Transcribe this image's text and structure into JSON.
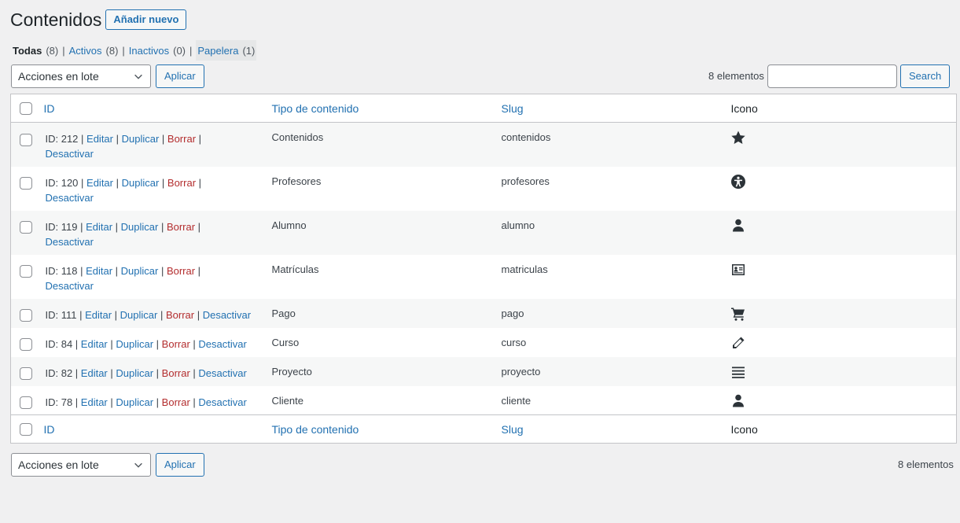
{
  "page": {
    "title": "Contenidos",
    "add_new": "Añadir nuevo"
  },
  "filters": [
    {
      "label": "Todas",
      "count": "(8)",
      "current": true
    },
    {
      "label": "Activos",
      "count": "(8)"
    },
    {
      "label": "Inactivos",
      "count": "(0)"
    },
    {
      "label": "Papelera",
      "count": "(1)"
    }
  ],
  "bulk": {
    "select_value": "Acciones en lote",
    "apply": "Aplicar"
  },
  "search": {
    "count": "8 elementos",
    "button": "Search",
    "value": ""
  },
  "columns": {
    "id": "ID",
    "tipo": "Tipo de contenido",
    "slug": "Slug",
    "icono": "Icono"
  },
  "actions": {
    "edit": "Editar",
    "duplicate": "Duplicar",
    "delete": "Borrar",
    "deactivate": "Desactivar"
  },
  "rows": [
    {
      "id": "ID: 212",
      "tipo": "Contenidos",
      "slug": "contenidos",
      "icon": "star-icon"
    },
    {
      "id": "ID: 120",
      "tipo": "Profesores",
      "slug": "profesores",
      "icon": "universal-access-icon"
    },
    {
      "id": "ID: 119",
      "tipo": "Alumno",
      "slug": "alumno",
      "icon": "person-icon"
    },
    {
      "id": "ID: 118",
      "tipo": "Matrículas",
      "slug": "matriculas",
      "icon": "id-card-icon"
    },
    {
      "id": "ID: 111",
      "tipo": "Pago",
      "slug": "pago",
      "icon": "cart-icon"
    },
    {
      "id": "ID: 84",
      "tipo": "Curso",
      "slug": "curso",
      "icon": "pencil-icon"
    },
    {
      "id": "ID: 82",
      "tipo": "Proyecto",
      "slug": "proyecto",
      "icon": "lines-icon"
    },
    {
      "id": "ID: 78",
      "tipo": "Cliente",
      "slug": "cliente",
      "icon": "person-icon"
    }
  ],
  "colors": {
    "link": "#2271b1",
    "delete": "#b32d2e",
    "background": "#f0f0f1"
  }
}
